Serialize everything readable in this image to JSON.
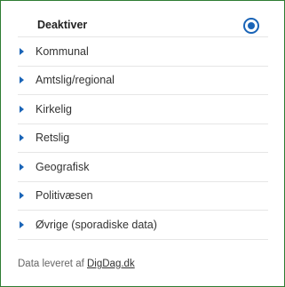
{
  "header": {
    "label": "Deaktiver",
    "selected": true
  },
  "categories": [
    {
      "label": "Kommunal"
    },
    {
      "label": "Amtslig/regional"
    },
    {
      "label": "Kirkelig"
    },
    {
      "label": "Retslig"
    },
    {
      "label": "Geografisk"
    },
    {
      "label": "Politivæsen"
    },
    {
      "label": "Øvrige (sporadiske data)"
    }
  ],
  "footer": {
    "text": "Data leveret af",
    "link": "DigDag.dk"
  },
  "colors": {
    "accent": "#1a64b7",
    "border": "#2e7d32"
  },
  "icons": {
    "expand": "caret-right-icon",
    "radio": "radio-selected-icon"
  }
}
